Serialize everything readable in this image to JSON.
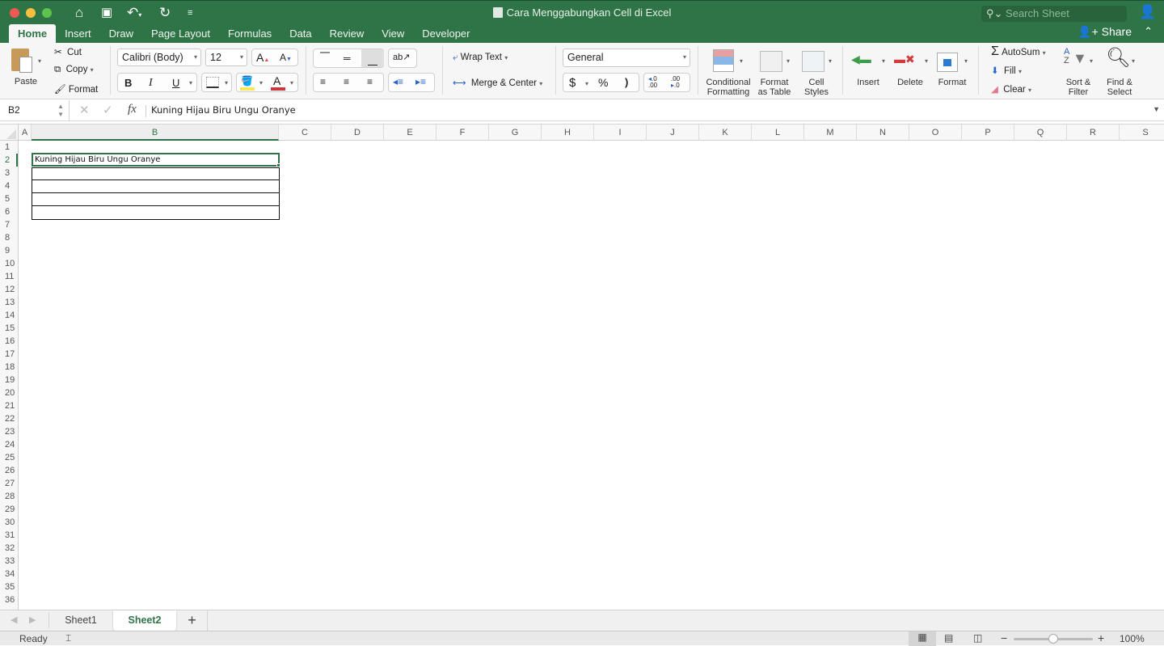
{
  "window": {
    "title": "Cara Menggabungkan Cell di Excel",
    "search_placeholder": "Search Sheet",
    "share_label": "Share"
  },
  "ribbon_tabs": [
    {
      "label": "Home",
      "active": true
    },
    {
      "label": "Insert"
    },
    {
      "label": "Draw"
    },
    {
      "label": "Page Layout"
    },
    {
      "label": "Formulas"
    },
    {
      "label": "Data"
    },
    {
      "label": "Review"
    },
    {
      "label": "View"
    },
    {
      "label": "Developer"
    }
  ],
  "clipboard": {
    "paste": "Paste",
    "cut": "Cut",
    "copy": "Copy",
    "format": "Format"
  },
  "font": {
    "name": "Calibri (Body)",
    "size": "12",
    "bold": "B",
    "italic": "I",
    "underline": "U"
  },
  "alignment": {
    "wrap_text": "Wrap Text",
    "merge_center": "Merge & Center"
  },
  "number": {
    "format": "General",
    "currency": "$",
    "percent": "%",
    "comma": ")",
    "inc_decimal": ".00",
    "dec_decimal": ".0"
  },
  "styles": {
    "conditional_1": "Conditional",
    "conditional_2": "Formatting",
    "format_table_1": "Format",
    "format_table_2": "as Table",
    "cell_styles_1": "Cell",
    "cell_styles_2": "Styles"
  },
  "cells_group": {
    "insert": "Insert",
    "delete": "Delete",
    "format": "Format"
  },
  "editing": {
    "autosum": "AutoSum",
    "fill": "Fill",
    "clear": "Clear",
    "sort_1": "Sort &",
    "sort_2": "Filter",
    "find_1": "Find &",
    "find_2": "Select"
  },
  "formula_bar": {
    "name_box": "B2",
    "fx": "fx",
    "content": "Kuning Hijau Biru Ungu Oranye"
  },
  "columns": [
    "A",
    "B",
    "C",
    "D",
    "E",
    "F",
    "G",
    "H",
    "I",
    "J",
    "K",
    "L",
    "M",
    "N",
    "O",
    "P",
    "Q",
    "R",
    "S"
  ],
  "selected_column": "B",
  "rows": [
    "1",
    "2",
    "3",
    "4",
    "5",
    "6",
    "7",
    "8",
    "9",
    "10",
    "11",
    "12",
    "13",
    "14",
    "15",
    "16",
    "17",
    "18",
    "19",
    "20",
    "21",
    "22",
    "23",
    "24",
    "25",
    "26",
    "27",
    "28",
    "29",
    "30",
    "31",
    "32",
    "33",
    "34",
    "35",
    "36"
  ],
  "selected_row": "2",
  "cells": {
    "B2": "Kuning Hijau Biru Ungu Oranye"
  },
  "sheets": [
    {
      "label": "Sheet1"
    },
    {
      "label": "Sheet2",
      "active": true
    }
  ],
  "add_sheet": "+",
  "status": {
    "ready": "Ready",
    "zoom": "100%",
    "zoom_fraction": 0.5
  },
  "colors": {
    "accent": "#2f7446"
  }
}
